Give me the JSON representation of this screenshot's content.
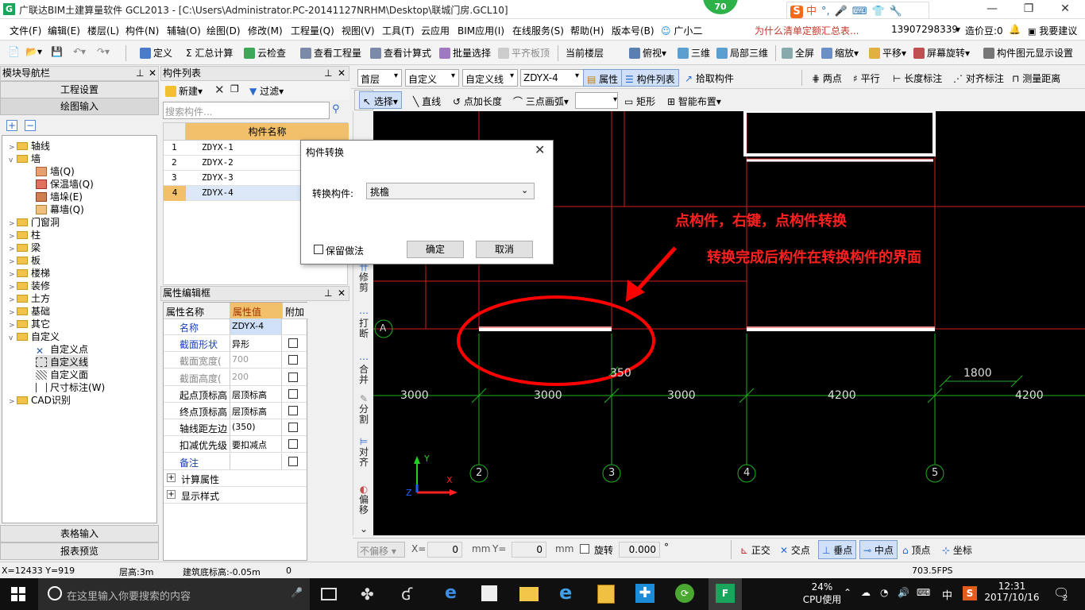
{
  "window": {
    "title": "广联达BIM土建算量软件 GCL2013 - [C:\\Users\\Administrator.PC-20141127NRHM\\Desktop\\联城门房.GCL10]",
    "app_icon": "G",
    "badge_number": "70",
    "minimize": "—",
    "restore": "❐",
    "close": "✕"
  },
  "ime": {
    "logo": "S",
    "items": [
      "中",
      "°,",
      "🎤",
      "⌨",
      "👕",
      "🔧"
    ]
  },
  "menu": {
    "items": [
      "文件(F)",
      "编辑(E)",
      "楼层(L)",
      "构件(N)",
      "辅轴(O)",
      "绘图(D)",
      "修改(M)",
      "工程量(Q)",
      "视图(V)",
      "工具(T)",
      "云应用",
      "BIM应用(I)",
      "在线服务(S)",
      "帮助(H)",
      "版本号(B)",
      "广小二"
    ],
    "ad_text": "为什么清单定额汇总表...",
    "account": "13907298339",
    "zaojia": "造价豆:0",
    "suggest": "我要建议"
  },
  "toolbar": {
    "items": [
      "定义",
      "Σ 汇总计算",
      "云检查",
      "查看工程量",
      "查看计算式",
      "批量选择",
      "平齐板顶",
      "当前楼层",
      "俯视",
      "三维",
      "局部三维",
      "全屏",
      "缩放",
      "平移",
      "屏幕旋转",
      "构件图元显示设置"
    ]
  },
  "nav_panel": {
    "title": "模块导航栏",
    "btn_project": "工程设置",
    "btn_draw": "绘图输入",
    "tree": {
      "axis": "轴线",
      "wall": "墙",
      "wall_children": [
        "墙(Q)",
        "保温墙(Q)",
        "墙垛(E)",
        "幕墙(Q)"
      ],
      "others": [
        "门窗洞",
        "柱",
        "梁",
        "板",
        "楼梯",
        "装修",
        "土方",
        "基础",
        "其它"
      ],
      "custom": "自定义",
      "custom_children": [
        "自定义点",
        "自定义线",
        "自定义面",
        "尺寸标注(W)"
      ],
      "cad": "CAD识别"
    },
    "btn_table": "表格输入",
    "btn_report": "报表预览"
  },
  "component_list": {
    "title": "构件列表",
    "new_btn": "新建",
    "filter_btn": "过滤",
    "search_placeholder": "搜索构件...",
    "col_header": "构件名称",
    "rows": [
      {
        "no": "1",
        "name": "ZDYX-1"
      },
      {
        "no": "2",
        "name": "ZDYX-2"
      },
      {
        "no": "3",
        "name": "ZDYX-3"
      },
      {
        "no": "4",
        "name": "ZDYX-4"
      }
    ]
  },
  "property_panel": {
    "title": "属性编辑框",
    "headers": [
      "属性名称",
      "属性值",
      "附加"
    ],
    "rows": [
      {
        "name": "名称",
        "value": "ZDYX-4"
      },
      {
        "name": "截面形状",
        "value": "异形"
      },
      {
        "name": "截面宽度(",
        "value": "700"
      },
      {
        "name": "截面高度(",
        "value": "200"
      },
      {
        "name": "起点顶标高",
        "value": "层顶标高"
      },
      {
        "name": "终点顶标高",
        "value": "层顶标高"
      },
      {
        "name": "轴线距左边",
        "value": "(350)"
      },
      {
        "name": "扣减优先级",
        "value": "要扣减点"
      },
      {
        "name": "备注",
        "value": ""
      },
      {
        "name": "计算属性",
        "value": ""
      },
      {
        "name": "显示样式",
        "value": ""
      }
    ]
  },
  "draw_toolbar": {
    "floor": "首层",
    "type1": "自定义",
    "type2": "自定义线",
    "comp": "ZDYX-4",
    "attr_btn": "属性",
    "list_btn": "构件列表",
    "pick_btn": "拾取构件",
    "right_items": [
      "两点",
      "平行",
      "长度标注",
      "对齐标注",
      "测量距离"
    ],
    "row2": [
      "选择",
      "直线",
      "点加长度",
      "三点画弧",
      "矩形",
      "智能布置"
    ]
  },
  "vertical_tools": [
    "修剪",
    "打断",
    "合并",
    "分割",
    "对齐",
    "偏移"
  ],
  "dialog": {
    "title": "构件转换",
    "label": "转换构件:",
    "value": "挑檐",
    "checkbox_label": "保留做法",
    "ok": "确定",
    "cancel": "取消"
  },
  "cad": {
    "annotation1": "点构件，右键，点构件转换",
    "annotation2": "转换完成后构件在转换构件的界面",
    "axis_A": "A",
    "dims": [
      "3000",
      "3000",
      "3000",
      "4200",
      "4200",
      "1800",
      "350"
    ],
    "axis_nums": [
      "2",
      "3",
      "4",
      "5"
    ],
    "ucs_y": "Y",
    "ucs_x": "X",
    "ucs_z": "Z"
  },
  "snap_bar": {
    "mode": "不偏移",
    "x_label": "X=",
    "x_val": "0",
    "unit": "mm",
    "y_label": "Y=",
    "y_val": "0",
    "rotate_label": "旋转",
    "rotate_val": "0.000",
    "deg": "°",
    "snaps": [
      "正交",
      "交点",
      "垂点",
      "中点",
      "顶点",
      "坐标"
    ]
  },
  "statusbar": {
    "coords": "X=12433 Y=919",
    "floor_height": "层高:3m",
    "base_elev": "建筑底标高:-0.05m",
    "zero": "0",
    "fps": "703.5FPS"
  },
  "taskbar": {
    "search_placeholder": "在这里输入你要搜索的内容",
    "cpu_pct": "24%",
    "cpu_label": "CPU使用",
    "lang": "中",
    "time": "12:31",
    "date": "2017/10/16",
    "notif_count": "2"
  }
}
